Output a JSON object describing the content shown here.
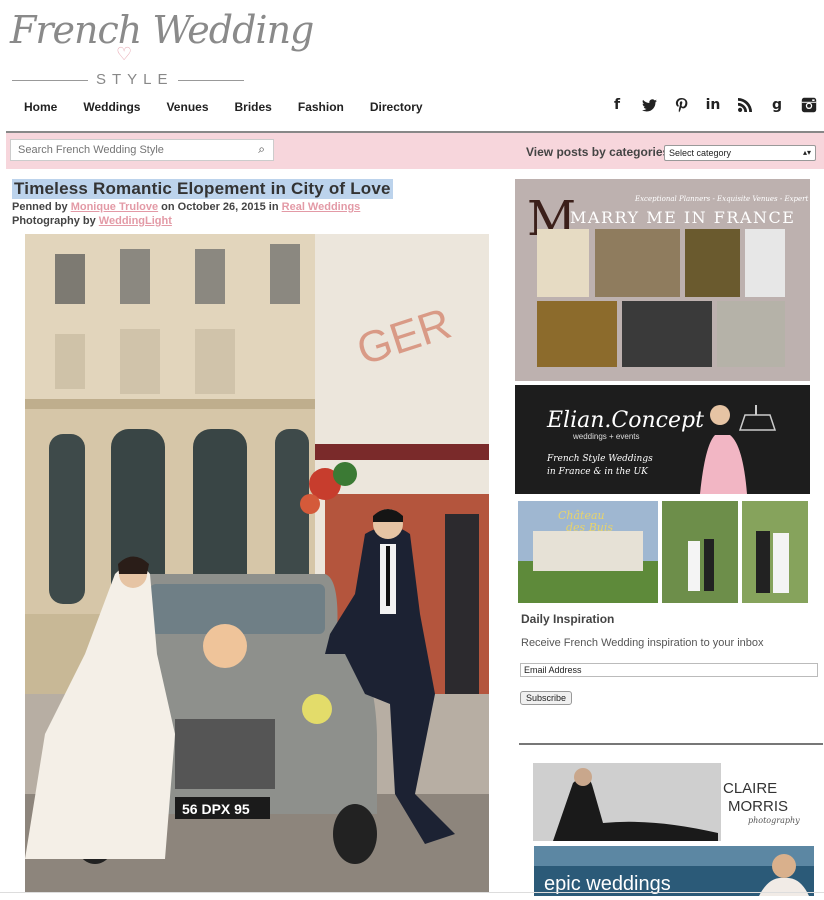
{
  "header": {
    "logo_script": "French Wedding",
    "logo_style": "STYLE"
  },
  "nav": [
    "Home",
    "Weddings",
    "Venues",
    "Brides",
    "Fashion",
    "Directory"
  ],
  "social_icons": [
    "facebook-icon",
    "twitter-icon",
    "pinterest-icon",
    "linkedin-icon",
    "rss-icon",
    "google-plus-icon",
    "instagram-icon"
  ],
  "search": {
    "placeholder": "Search French Wedding Style"
  },
  "categories": {
    "label": "View posts by categories:",
    "selected": "Select category"
  },
  "post": {
    "title": "Timeless Romantic Elopement in City of Love",
    "penned_prefix": "Penned by",
    "author": "Monique Trulove",
    "date_prefix": "on",
    "date": "October 26, 2015",
    "in_prefix": "in",
    "category": "Real Weddings",
    "photo_prefix": "Photography by",
    "photographer": "WeddingLight",
    "plate": "56 DPX 95"
  },
  "ads": {
    "marry": {
      "tagline": "Exceptional Planners - Exquisite Venues - Expert Styling",
      "title": "MARRY ME IN FRANCE"
    },
    "elian": {
      "title": "Elian.Concept",
      "sub": "weddings + events",
      "line1": "French Style Weddings",
      "line2": "in France & in the UK"
    },
    "chateau": {
      "name1": "Château",
      "name2": "des Buis"
    },
    "claire": {
      "name1": "CLAIRE",
      "name2": "MORRIS",
      "sub": "photography"
    },
    "epic": {
      "name": "epic weddings"
    }
  },
  "daily": {
    "title": "Daily Inspiration",
    "subtitle": "Receive French Wedding inspiration to your inbox",
    "email_value": "Email Address",
    "subscribe": "Subscribe"
  },
  "colors": {
    "band": "#f7d6dc",
    "accent_pink": "#e39aa6",
    "title_highlight": "#bcd3ec"
  }
}
